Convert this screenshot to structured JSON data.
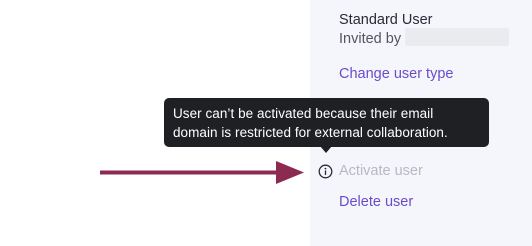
{
  "user": {
    "role": "Standard User",
    "invited_by_label": "Invited by"
  },
  "actions": {
    "change_user_type": "Change user type",
    "activate_user": "Activate user",
    "delete_user": "Delete user"
  },
  "tooltip": {
    "line1": "User can’t be activated because their email",
    "line2": "domain is restricted for external collaboration."
  },
  "icons": {
    "info": "info-circle-icon",
    "annotation_arrow": "arrow-right-icon"
  },
  "colors": {
    "link": "#6b4bc9",
    "disabled": "#b9b9c2",
    "tooltip_bg": "#1f2023",
    "panel_bg": "#f4f6fb",
    "annotation_arrow": "#8c2a52"
  }
}
